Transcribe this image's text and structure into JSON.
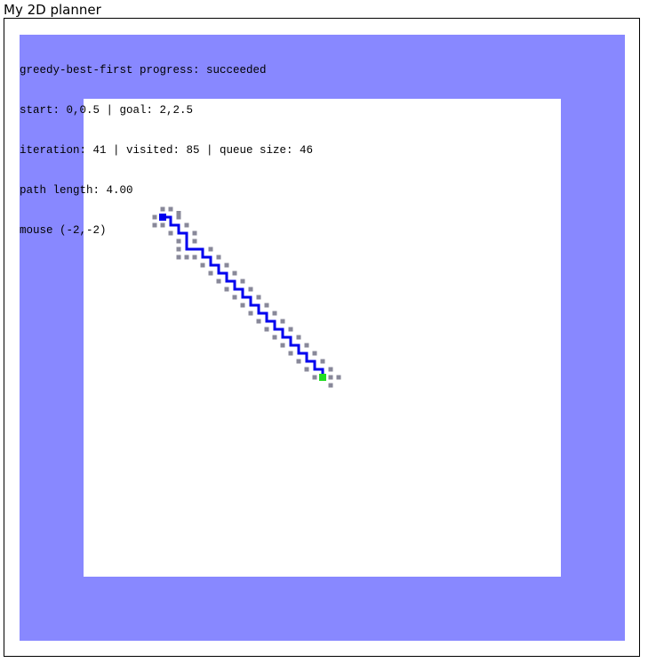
{
  "app": {
    "title": "My 2D planner"
  },
  "status": {
    "progress_line": "greedy-best-first progress: succeeded",
    "start_goal_line": "start: 0,0.5 | goal: 2,2.5",
    "counts_line": "iteration: 41 | visited: 85 | queue size: 46",
    "path_line": "path length: 4.00",
    "mouse_line": "mouse (-2,-2)"
  },
  "colors": {
    "obstacle": "#8888ff",
    "free_space": "#ffffff",
    "path": "#0000ee",
    "start_marker": "#0000ee",
    "goal_marker": "#22dd22",
    "visited_node": "#888899"
  },
  "start_cell": [
    0,
    0
  ],
  "goal_cell": [
    20,
    20
  ],
  "path_cells": [
    [
      0,
      0
    ],
    [
      1,
      0
    ],
    [
      1,
      1
    ],
    [
      2,
      1
    ],
    [
      2,
      2
    ],
    [
      3,
      2
    ],
    [
      3,
      3
    ],
    [
      3,
      4
    ],
    [
      4,
      4
    ],
    [
      5,
      4
    ],
    [
      5,
      5
    ],
    [
      6,
      5
    ],
    [
      6,
      6
    ],
    [
      7,
      6
    ],
    [
      7,
      7
    ],
    [
      8,
      7
    ],
    [
      8,
      8
    ],
    [
      9,
      8
    ],
    [
      9,
      9
    ],
    [
      10,
      9
    ],
    [
      10,
      10
    ],
    [
      11,
      10
    ],
    [
      11,
      11
    ],
    [
      12,
      11
    ],
    [
      12,
      12
    ],
    [
      13,
      12
    ],
    [
      13,
      13
    ],
    [
      14,
      13
    ],
    [
      14,
      14
    ],
    [
      15,
      14
    ],
    [
      15,
      15
    ],
    [
      16,
      15
    ],
    [
      16,
      16
    ],
    [
      17,
      16
    ],
    [
      17,
      17
    ],
    [
      18,
      17
    ],
    [
      18,
      18
    ],
    [
      19,
      18
    ],
    [
      19,
      19
    ],
    [
      20,
      19
    ],
    [
      20,
      20
    ]
  ],
  "visited_cells": [
    [
      0,
      -1
    ],
    [
      1,
      -1
    ],
    [
      -1,
      0
    ],
    [
      2,
      0
    ],
    [
      0,
      1
    ],
    [
      -1,
      1
    ],
    [
      2,
      -0.5
    ],
    [
      3,
      1
    ],
    [
      1,
      2
    ],
    [
      4,
      2
    ],
    [
      2,
      3
    ],
    [
      4,
      3
    ],
    [
      2,
      4
    ],
    [
      2,
      5
    ],
    [
      3,
      5
    ],
    [
      4,
      5
    ],
    [
      6,
      4
    ],
    [
      7,
      5
    ],
    [
      5,
      6
    ],
    [
      8,
      6
    ],
    [
      6,
      7
    ],
    [
      9,
      7
    ],
    [
      7,
      8
    ],
    [
      10,
      8
    ],
    [
      8,
      9
    ],
    [
      11,
      9
    ],
    [
      9,
      10
    ],
    [
      12,
      10
    ],
    [
      10,
      11
    ],
    [
      13,
      11
    ],
    [
      11,
      12
    ],
    [
      14,
      12
    ],
    [
      12,
      13
    ],
    [
      15,
      13
    ],
    [
      13,
      14
    ],
    [
      16,
      14
    ],
    [
      14,
      15
    ],
    [
      17,
      15
    ],
    [
      15,
      16
    ],
    [
      18,
      16
    ],
    [
      16,
      17
    ],
    [
      19,
      17
    ],
    [
      17,
      18
    ],
    [
      20,
      18
    ],
    [
      18,
      19
    ],
    [
      21,
      19
    ],
    [
      19,
      20
    ],
    [
      21,
      20
    ],
    [
      22,
      20
    ],
    [
      21,
      21
    ]
  ]
}
